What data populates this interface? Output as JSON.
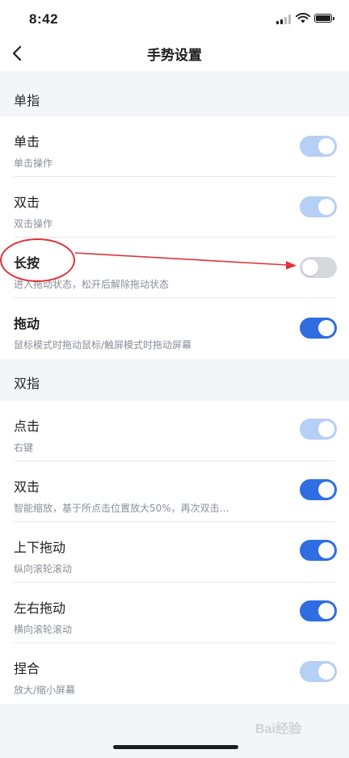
{
  "status_bar": {
    "time": "8:42"
  },
  "nav": {
    "title": "手势设置"
  },
  "colors": {
    "toggle_on": "#2f6de1",
    "toggle_on_disabled": "#b5cff5",
    "toggle_off": "#d6d8dc",
    "annotation": "#e0333c"
  },
  "sections": [
    {
      "header": "单指",
      "items": [
        {
          "title": "单击",
          "subtitle": "单击操作",
          "state": "on-disabled"
        },
        {
          "title": "双击",
          "subtitle": "双击操作",
          "state": "on-disabled"
        },
        {
          "title": "长按",
          "subtitle": "进入拖动状态，松开后解除拖动状态",
          "state": "off"
        },
        {
          "title": "拖动",
          "subtitle": "鼠标模式时拖动鼠标/触屏模式时拖动屏幕",
          "state": "on"
        }
      ]
    },
    {
      "header": "双指",
      "items": [
        {
          "title": "点击",
          "subtitle": "右键",
          "state": "on-disabled"
        },
        {
          "title": "双击",
          "subtitle": "智能缩放，基于所点击位置放大50%，再次双击…",
          "state": "on"
        },
        {
          "title": "上下拖动",
          "subtitle": "纵向滚轮滚动",
          "state": "on"
        },
        {
          "title": "左右拖动",
          "subtitle": "横向滚轮滚动",
          "state": "on"
        },
        {
          "title": "捏合",
          "subtitle": "放大/缩小屏幕",
          "state": "on-disabled"
        }
      ]
    }
  ],
  "watermark": "Bai经验"
}
